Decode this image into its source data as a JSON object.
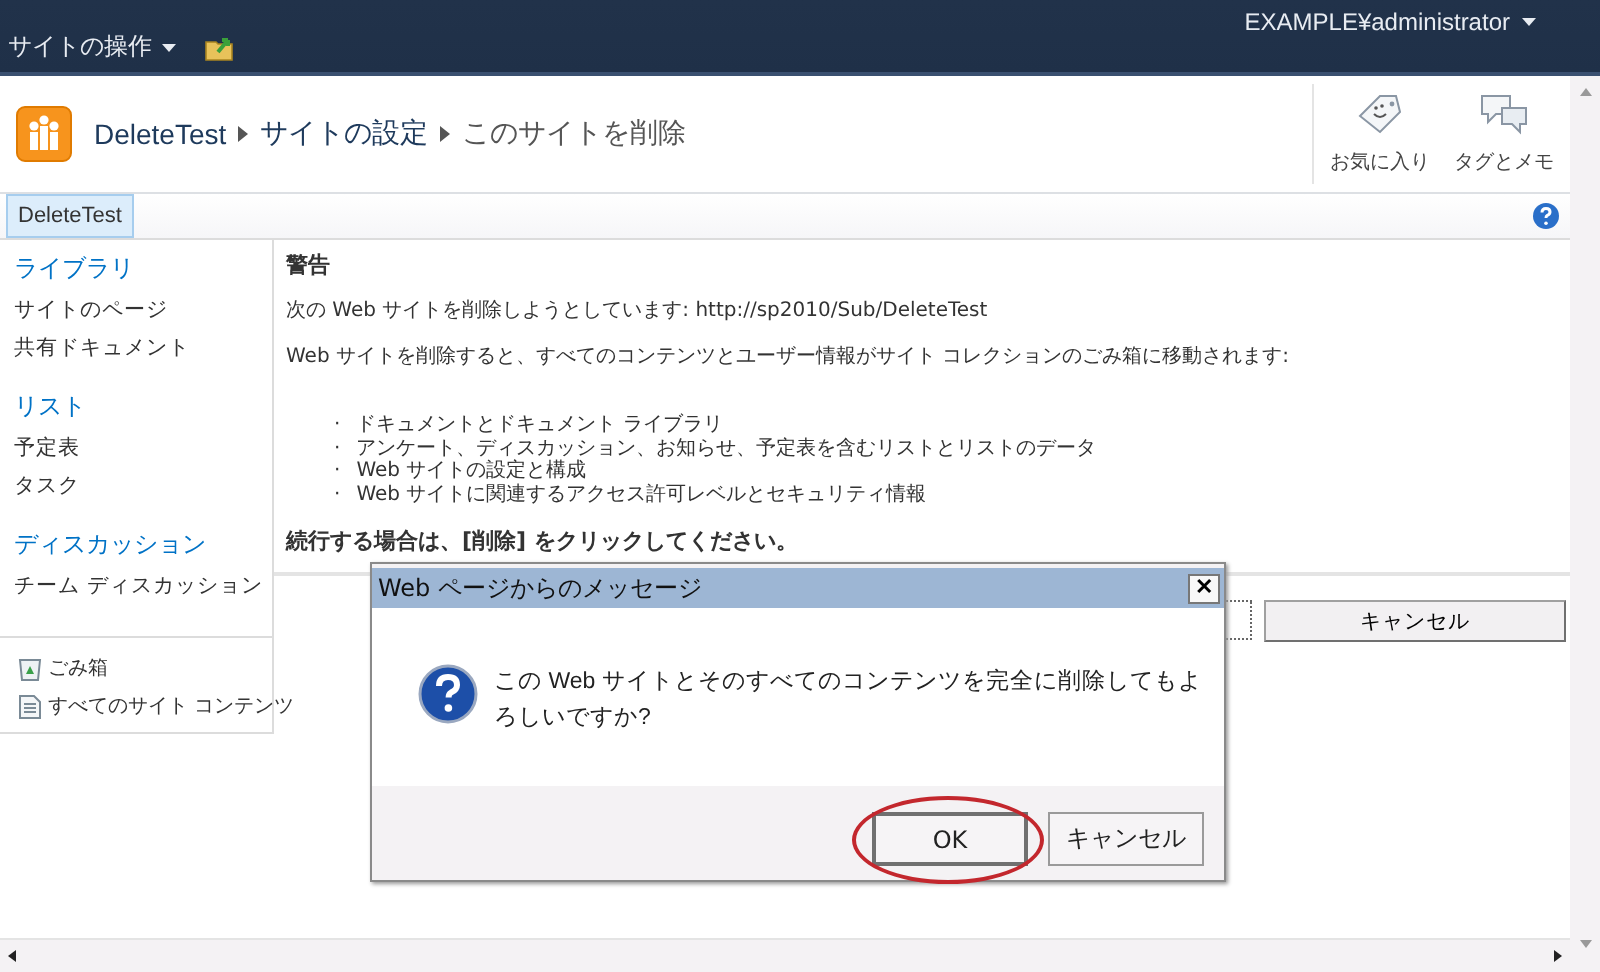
{
  "top_bar": {
    "site_actions": "サイトの操作",
    "user": "EXAMPLE¥administrator"
  },
  "breadcrumb": [
    "DeleteTest",
    "サイトの設定",
    "このサイトを削除"
  ],
  "ribbon_actions": [
    {
      "label": "お気に入り",
      "kind": "favorite"
    },
    {
      "label": "タグとメモ",
      "kind": "tags"
    }
  ],
  "tabs": [
    {
      "label": "DeleteTest",
      "selected": true
    }
  ],
  "sidebar": {
    "groups": [
      {
        "heading": "ライブラリ",
        "items": [
          "サイトのページ",
          "共有ドキュメント"
        ]
      },
      {
        "heading": "リスト",
        "items": [
          "予定表",
          "タスク"
        ]
      },
      {
        "heading": "ディスカッション",
        "items": [
          "チーム ディスカッション"
        ]
      }
    ],
    "footer": [
      {
        "label": "ごみ箱",
        "kind": "recycle"
      },
      {
        "label": "すべてのサイト コンテンツ",
        "kind": "contents"
      }
    ]
  },
  "content": {
    "heading": "警告",
    "paragraphs": [
      "次の Web サイトを削除しようとしています: http://sp2010/Sub/DeleteTest",
      "Web サイトを削除すると、すべてのコンテンツとユーザー情報がサイト コレクションのごみ箱に移動されます:"
    ],
    "bullets": [
      {
        "mark": "·",
        "text": "ドキュメントとドキュメント ライブラリ"
      },
      {
        "mark": "·",
        "text": "アンケート、ディスカッション、お知らせ、予定表を含むリストとリストのデータ"
      },
      {
        "mark": "·",
        "text": "Web サイトの設定と構成"
      },
      {
        "mark": "·",
        "text": "Web サイトに関連するアクセス許可レベルとセキュリティ情報"
      }
    ],
    "instruction": "続行する場合は、[削除] をクリックしてください。",
    "cancel_button": "キャンセル"
  },
  "dialog": {
    "title": "Web ページからのメッセージ",
    "close": "✕",
    "message": "この Web サイトとそのすべてのコンテンツを完全に削除してもよろしいですか?",
    "buttons": [
      {
        "label": "OK",
        "highlighted": true
      },
      {
        "label": "キャンセル",
        "highlighted": false
      }
    ]
  }
}
